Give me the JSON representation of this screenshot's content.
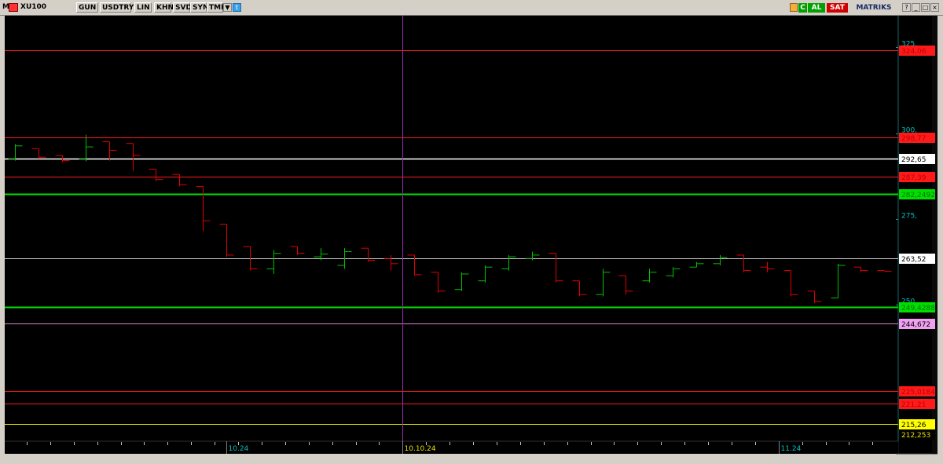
{
  "toolbar": {
    "logo": "M",
    "symbol": "XU100",
    "buttons": [
      "GUN",
      "USDTRY",
      "LIN",
      "KHN",
      "SVD",
      "SYM",
      "TMP"
    ],
    "buy_label": "AL",
    "sell_label": "SAT",
    "brand": "MATRIKS",
    "c_label": "C"
  },
  "colors": {
    "background": "#000000",
    "up_bar": "#00c000",
    "down_bar": "#e00000",
    "axis_label": "#00c0c0",
    "toolbar_bg": "#d4d0c8"
  },
  "chart_data": {
    "type": "ohlc",
    "symbol": "XU100",
    "ylim": [
      210.3,
      334.2
    ],
    "y_ticks": [
      {
        "value": 325,
        "label": "325,"
      },
      {
        "value": 300,
        "label": "300,"
      },
      {
        "value": 275,
        "label": "275,"
      },
      {
        "value": 250,
        "label": "250,"
      }
    ],
    "x_labels": [
      {
        "index": 9,
        "label": "10.24"
      },
      {
        "index": 16.5,
        "label": "10.10.24"
      },
      {
        "index": 32.5,
        "label": "11.24"
      }
    ],
    "vertical_marker_index": 16.5,
    "bars": [
      {
        "o": 292.5,
        "h": 296.8,
        "l": 292.0,
        "c": 296.3
      },
      {
        "o": 295.5,
        "h": 295.5,
        "l": 292.5,
        "c": 293.0
      },
      {
        "o": 293.5,
        "h": 293.5,
        "l": 291.5,
        "c": 292.0
      },
      {
        "o": 292.5,
        "h": 299.5,
        "l": 291.8,
        "c": 296.0
      },
      {
        "o": 297.5,
        "h": 297.5,
        "l": 292.0,
        "c": 295.0
      },
      {
        "o": 297.0,
        "h": 297.0,
        "l": 289.0,
        "c": 293.5
      },
      {
        "o": 289.5,
        "h": 289.5,
        "l": 286.0,
        "c": 286.5
      },
      {
        "o": 288.0,
        "h": 288.0,
        "l": 284.5,
        "c": 285.0
      },
      {
        "o": 284.5,
        "h": 284.5,
        "l": 271.5,
        "c": 274.5
      },
      {
        "o": 273.5,
        "h": 273.5,
        "l": 264.0,
        "c": 264.5
      },
      {
        "o": 267.0,
        "h": 267.0,
        "l": 260.0,
        "c": 260.5
      },
      {
        "o": 260.5,
        "h": 266.0,
        "l": 259.0,
        "c": 265.0
      },
      {
        "o": 267.0,
        "h": 267.0,
        "l": 264.5,
        "c": 265.0
      },
      {
        "o": 264.0,
        "h": 266.5,
        "l": 263.0,
        "c": 264.8
      },
      {
        "o": 261.5,
        "h": 266.5,
        "l": 260.5,
        "c": 265.5
      },
      {
        "o": 266.5,
        "h": 266.5,
        "l": 262.5,
        "c": 263.0
      },
      {
        "o": 263.5,
        "h": 264.5,
        "l": 260.0,
        "c": 262.0
      },
      {
        "o": 264.5,
        "h": 264.5,
        "l": 258.5,
        "c": 258.8
      },
      {
        "o": 259.5,
        "h": 259.5,
        "l": 253.5,
        "c": 254.0
      },
      {
        "o": 254.5,
        "h": 259.5,
        "l": 254.0,
        "c": 259.0
      },
      {
        "o": 257.0,
        "h": 261.5,
        "l": 256.5,
        "c": 261.0
      },
      {
        "o": 260.5,
        "h": 264.5,
        "l": 260.0,
        "c": 264.0
      },
      {
        "o": 263.5,
        "h": 265.5,
        "l": 263.0,
        "c": 264.5
      },
      {
        "o": 265.0,
        "h": 265.0,
        "l": 256.5,
        "c": 257.0
      },
      {
        "o": 257.0,
        "h": 257.0,
        "l": 252.5,
        "c": 253.0
      },
      {
        "o": 253.0,
        "h": 260.5,
        "l": 252.5,
        "c": 259.5
      },
      {
        "o": 258.5,
        "h": 258.5,
        "l": 253.0,
        "c": 254.0
      },
      {
        "o": 257.0,
        "h": 260.5,
        "l": 256.5,
        "c": 259.5
      },
      {
        "o": 258.5,
        "h": 261.0,
        "l": 258.0,
        "c": 260.5
      },
      {
        "o": 261.0,
        "h": 262.5,
        "l": 261.0,
        "c": 262.0
      },
      {
        "o": 262.0,
        "h": 264.5,
        "l": 261.5,
        "c": 263.8
      },
      {
        "o": 264.5,
        "h": 264.5,
        "l": 259.5,
        "c": 260.0
      },
      {
        "o": 261.0,
        "h": 262.5,
        "l": 259.5,
        "c": 260.5
      },
      {
        "o": 260.0,
        "h": 260.0,
        "l": 252.5,
        "c": 253.0
      },
      {
        "o": 254.0,
        "h": 254.0,
        "l": 250.5,
        "c": 251.0
      },
      {
        "o": 252.0,
        "h": 262.0,
        "l": 252.0,
        "c": 261.5
      },
      {
        "o": 261.0,
        "h": 261.0,
        "l": 259.5,
        "c": 260.0
      },
      {
        "o": 260.0,
        "h": 260.0,
        "l": 259.8,
        "c": 259.8
      }
    ],
    "levels": [
      {
        "value": 324.06,
        "label": "324,06",
        "color": "#ff1a1a",
        "bg": "#ff1a1a",
        "text": "#c00000"
      },
      {
        "value": 298.77,
        "label": "298,77",
        "color": "#ff1a1a",
        "bg": "#ff1a1a",
        "text": "#c00000"
      },
      {
        "value": 292.65,
        "label": "292,65",
        "color": "#ffffff",
        "bg": "#ffffff",
        "text": "#000000"
      },
      {
        "value": 287.39,
        "label": "287,39",
        "color": "#ff1a1a",
        "bg": "#ff1a1a",
        "text": "#c00000"
      },
      {
        "value": 282.2492,
        "label": "282,2492",
        "color": "#00e000",
        "bg": "#00e000",
        "text": "#007000"
      },
      {
        "value": 263.52,
        "label": "263,52",
        "color": "#c8c8c8",
        "bg": "#ffffff",
        "text": "#000000"
      },
      {
        "value": 249.4288,
        "label": "249,4288",
        "color": "#00e000",
        "bg": "#00e000",
        "text": "#007000"
      },
      {
        "value": 244.672,
        "label": "244,672",
        "color": "#e080e0",
        "bg": "#f0a0f0",
        "text": "#000000"
      },
      {
        "value": 225.0184,
        "label": "225,0184",
        "color": "#ff1a1a",
        "bg": "#ff1a1a",
        "text": "#c00000"
      },
      {
        "value": 221.21,
        "label": "221,21",
        "color": "#ff1a1a",
        "bg": "#ff1a1a",
        "text": "#c00000"
      },
      {
        "value": 215.26,
        "label": "215,26",
        "color": "#e8e000",
        "bg": "#ffff00",
        "text": "#000000"
      },
      {
        "value": 212.253,
        "label": "212,253",
        "color": "#000000",
        "bg": "#000000",
        "text": "#e8e000"
      }
    ]
  }
}
